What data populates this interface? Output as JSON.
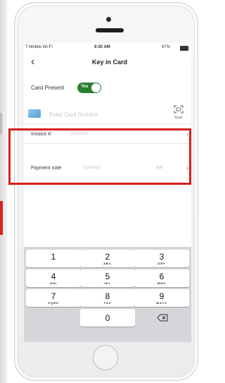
{
  "status_bar": {
    "carrier": "T-Mobile Wi-Fi",
    "time": "9:30 AM",
    "battery": "67%"
  },
  "nav": {
    "title": "Key in Card"
  },
  "card_present": {
    "label": "Card Present",
    "toggle_label": "Yes",
    "toggle_on": true
  },
  "card_number": {
    "placeholder": "Enter Card Number",
    "scan_label": "Scan"
  },
  "invoice": {
    "label": "Invoice #:",
    "placeholder": "(optional)"
  },
  "payment_note": {
    "label": "Payment note",
    "placeholder": "(optional)",
    "hint": "text"
  },
  "keypad": {
    "rows": [
      [
        {
          "digit": "1",
          "letters": ""
        },
        {
          "digit": "2",
          "letters": "ABC"
        },
        {
          "digit": "3",
          "letters": "DEF"
        }
      ],
      [
        {
          "digit": "4",
          "letters": "GHI"
        },
        {
          "digit": "5",
          "letters": "JKL"
        },
        {
          "digit": "6",
          "letters": "MNO"
        }
      ],
      [
        {
          "digit": "7",
          "letters": "PQRS"
        },
        {
          "digit": "8",
          "letters": "TUV"
        },
        {
          "digit": "9",
          "letters": "WXYZ"
        }
      ]
    ],
    "zero": "0"
  },
  "colors": {
    "toggle": "#2e7d32",
    "highlight": "#d51f1f",
    "keypad_bg": "#d4d6da"
  },
  "icons": {
    "back": "chevron-left-icon",
    "scan": "scan-icon",
    "delete": "backspace-icon"
  }
}
